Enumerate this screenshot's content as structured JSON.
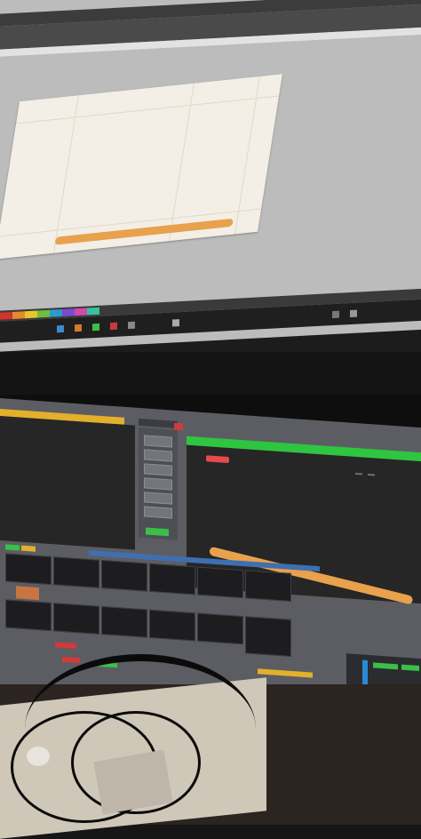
{
  "upper_monitor": {
    "menu_items": [
      "",
      "",
      ""
    ],
    "toolbar_items": [
      "",
      "",
      ""
    ],
    "document_text_left": "",
    "document_text_right": "",
    "swatch_colors": [
      "#d0342c",
      "#e7892c",
      "#e4c82c",
      "#6fbf3a",
      "#2c9ad0",
      "#7a4ad0",
      "#d04aa8",
      "#3ac0a0"
    ]
  },
  "lower_monitor": {
    "transition_title": "",
    "transition_buttons": [
      "",
      "",
      "",
      "",
      "",
      ""
    ],
    "preview_labels": [
      "",
      ""
    ],
    "program_buttons": [
      "",
      ""
    ],
    "colors": {
      "preview_tally": "#e3b02c",
      "program_tally": "#2ec540",
      "accent_orange": "#e8a14c",
      "bank_blue": "#3f6fb0",
      "alert_red": "#d03a3a"
    }
  }
}
